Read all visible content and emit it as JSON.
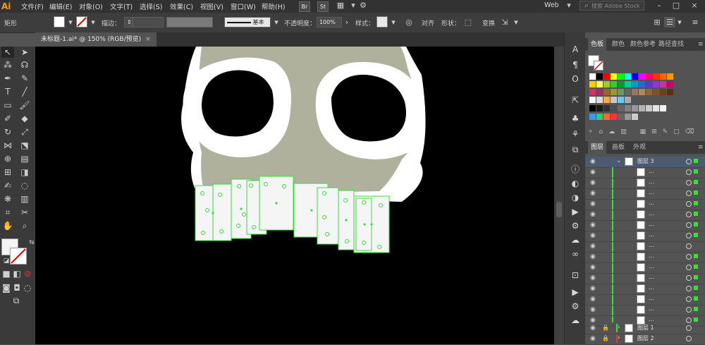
{
  "app": {
    "logo": "Ai"
  },
  "menu": [
    "文件(F)",
    "编辑(E)",
    "对象(O)",
    "文字(T)",
    "选择(S)",
    "效果(C)",
    "视图(V)",
    "窗口(W)",
    "帮助(H)"
  ],
  "menubar_chips": [
    "Br",
    "St"
  ],
  "workspace": {
    "label": "Web"
  },
  "search": {
    "placeholder": "搜索 Adobe Stock"
  },
  "control": {
    "tool_name": "矩形",
    "stroke_label": "描边：",
    "stroke_style": "基本",
    "opacity_label": "不透明度：",
    "opacity_value": "100%",
    "style_label": "样式：",
    "align_label": "对齐",
    "shape_label": "形状：",
    "transform_label": "变换"
  },
  "document": {
    "tab_title": "未标题-1.ai* @ 150% (RGB/预览)",
    "close": "×"
  },
  "panels": {
    "swatches_tabs": [
      "色板",
      "颜色",
      "颜色参考",
      "路径查找"
    ],
    "layers_tabs": [
      "图层",
      "画板",
      "外观"
    ]
  },
  "swatch_colors": [
    [
      "#ffffff",
      "#000000",
      "#ff0000",
      "#ffff00",
      "#00ff00",
      "#00ffff",
      "#0000ff",
      "#ff00ff",
      "#ff0066",
      "#ff3300",
      "#ff6600",
      "#ff9900"
    ],
    [
      "#ffcc00",
      "#ffff66",
      "#99cc33",
      "#33cc33",
      "#009933",
      "#00cc99",
      "#0099cc",
      "#3366cc",
      "#6633cc",
      "#9933cc",
      "#cc3399",
      "#cc0066"
    ],
    [
      "#cc3366",
      "#993366",
      "#996633",
      "#999933",
      "#669966",
      "#666666",
      "#997766",
      "#aa8866",
      "#886644",
      "#775533",
      "#664422",
      "#553311"
    ],
    [
      "#ffffff",
      "#dddddd",
      "#ffaa44",
      "#c8c8c8",
      "#66ccff",
      "#aaaaaa"
    ],
    [
      "#000000",
      "#1a1a1a",
      "#333333",
      "#4d4d4d",
      "#666666",
      "#808080",
      "#999999",
      "#b3b3b3",
      "#cccccc",
      "#e6e6e6",
      "#f2f2f2"
    ],
    [
      "#3399ff",
      "#33cc66",
      "#ff6633",
      "#ff3333",
      "#666666",
      "#999999",
      "#cccccc"
    ]
  ],
  "layers": {
    "top_layer": "图层 3",
    "sublayer_label": "...",
    "sublayer_count": 15,
    "bottom_layers": [
      "图层 1",
      "图层 2"
    ]
  }
}
